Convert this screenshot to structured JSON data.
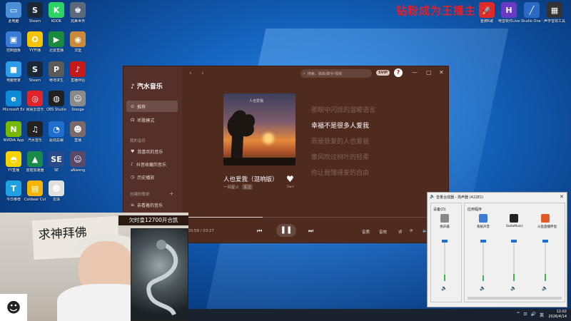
{
  "banner": {
    "text": "钻粉成为王播主"
  },
  "desktop_icons": [
    {
      "label": "此电脑",
      "color": "#4a90d9",
      "glyph": "▭"
    },
    {
      "label": "Steam",
      "color": "#1b2838",
      "glyph": "S"
    },
    {
      "label": "KOOK",
      "color": "#2bd463",
      "glyph": "K"
    },
    {
      "label": "完美世界",
      "color": "#5b6a7a",
      "glyph": "♚"
    },
    {
      "label": "控制面板",
      "color": "#3b7bd4",
      "glyph": "▣"
    },
    {
      "label": "YY开播",
      "color": "#f5c400",
      "glyph": "O"
    },
    {
      "label": "迅雷直播",
      "color": "#1c8a3c",
      "glyph": "▶"
    },
    {
      "label": "汉堡",
      "color": "#c98b3a",
      "glyph": "◉"
    },
    {
      "label": "电脑管家",
      "color": "#2f9be8",
      "glyph": "■"
    },
    {
      "label": "Steam",
      "color": "#1b2838",
      "glyph": "S"
    },
    {
      "label": "绝地求生",
      "color": "#5a5a5a",
      "glyph": "P"
    },
    {
      "label": "直播伴侣",
      "color": "#c41a1a",
      "glyph": "♪"
    },
    {
      "label": "Microsoft Edge",
      "color": "#0f8ad6",
      "glyph": "e"
    },
    {
      "label": "网易云音乐",
      "color": "#e0242a",
      "glyph": "◎"
    },
    {
      "label": "OBS Studio",
      "color": "#202020",
      "glyph": "◍"
    },
    {
      "label": "Stooge",
      "color": "#8a8a8a",
      "glyph": "☺"
    },
    {
      "label": "NVIDIA App",
      "color": "#76b900",
      "glyph": "N"
    },
    {
      "label": "汽水音乐",
      "color": "#222222",
      "glyph": "♫"
    },
    {
      "label": "驱动总裁",
      "color": "#1f6fd1",
      "glyph": "◔"
    },
    {
      "label": "直播",
      "color": "#7a6a6a",
      "glyph": "☻"
    },
    {
      "label": "YY直播",
      "color": "#f5d400",
      "glyph": "◓"
    },
    {
      "label": "雷霆加速器",
      "color": "#1a8a4a",
      "glyph": "▲"
    },
    {
      "label": "SE",
      "color": "#2a4a8a",
      "glyph": "SE"
    },
    {
      "label": "aNweng",
      "color": "#5a4a6a",
      "glyph": "☺"
    },
    {
      "label": "今日推荐",
      "color": "#1fa0e0",
      "glyph": "T"
    },
    {
      "label": "Coldwar Cut",
      "color": "#f5b400",
      "glyph": "▤"
    },
    {
      "label": "龙珠",
      "color": "#e0e0e0",
      "glyph": "☻"
    }
  ],
  "topright_icons": [
    {
      "label": "金牌K歌",
      "color": "#e02a2a",
      "glyph": "🚀"
    },
    {
      "label": "电音软件Live",
      "color": "#6a3ac4",
      "glyph": "H"
    },
    {
      "label": "Studio One 5",
      "color": "#2a6ac4",
      "glyph": "╱"
    },
    {
      "label": "声学音效工具箱",
      "color": "#333333",
      "glyph": "▦"
    }
  ],
  "music_app": {
    "title": "汽水音乐",
    "nav": [
      {
        "label": "推荐",
        "icon": "home-icon",
        "glyph": "⊙",
        "active": true
      },
      {
        "label": "听歌模式",
        "icon": "headphones-icon",
        "glyph": "☊",
        "active": false
      }
    ],
    "my_music_header": "我的音乐",
    "my_music": [
      {
        "label": "我喜欢的音乐",
        "glyph": "♥",
        "icon": "heart-icon"
      },
      {
        "label": "抖音收藏的音乐",
        "glyph": "♪",
        "icon": "douyin-icon"
      },
      {
        "label": "历史播放",
        "glyph": "◷",
        "icon": "history-icon"
      }
    ],
    "playlist_header": "创建的歌单",
    "playlists": [
      {
        "label": "亲看着的音乐",
        "glyph": "≡",
        "icon": "playlist-icon"
      }
    ],
    "search_placeholder": "搜索，歌曲/歌手/视频",
    "svip": "SVIP",
    "cover_text": "人也爱我",
    "song": {
      "title": "人也爱我（混响版）",
      "artist": "一间星火",
      "follow": "关注",
      "likes": "5w+",
      "time": "00:59 / 03:27",
      "progress": 0.3
    },
    "lyrics": [
      {
        "text": "那眼中闪烁的温暖语言",
        "current": false
      },
      {
        "text": "幸福不是很多人爱我",
        "current": true
      },
      {
        "text": "而是我爱的人也爱我",
        "current": false
      },
      {
        "text": "像风吹过树叶的轻柔",
        "current": false
      },
      {
        "text": "你让我懂得爱的自由",
        "current": false
      }
    ],
    "controls": {
      "prev": "⏮",
      "pause": "❚❚",
      "next": "⏭",
      "quality": "音质",
      "sound": "音效",
      "comment": "评",
      "loop": "⟳",
      "volume": "🔈"
    }
  },
  "stream": {
    "donation": "欠时皇12700开合凯",
    "calligraphy": "求神拜佛"
  },
  "mixer": {
    "title": "音量合成器 - 扬声器 (422E1)",
    "device_label": "设备(D)",
    "apps_label": "应用程序",
    "channels": [
      {
        "name": "扬声器",
        "color": "#888888",
        "level": 0.5
      },
      {
        "name": "系统声音",
        "color": "#3b7bd4",
        "level": 0.45
      },
      {
        "name": "SodaMusic",
        "color": "#222222",
        "level": 0.6
      },
      {
        "name": "斗鱼直播伴侣",
        "color": "#e05a2a",
        "level": 0.55
      }
    ]
  },
  "taskbar": {
    "time": "12:02",
    "date": "2026/4/14",
    "ime": "英",
    "tray": [
      "^",
      "⊡",
      "🔊",
      "英"
    ]
  }
}
